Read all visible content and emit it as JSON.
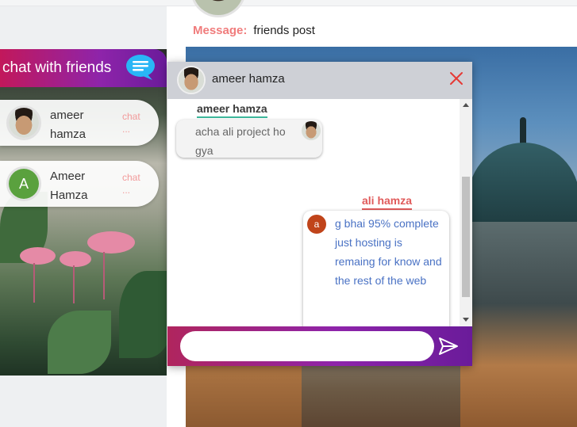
{
  "post": {
    "message_label": "Message:",
    "message_text": "friends post"
  },
  "friends_panel": {
    "title": "chat with friends",
    "items": [
      {
        "name": "ameer hamza",
        "action": "chat",
        "extra": "..."
      },
      {
        "name": "Ameer Hamza",
        "avatar_letter": "A",
        "action": "chat",
        "extra": "..."
      }
    ]
  },
  "chat": {
    "header_name": "ameer hamza",
    "messages": [
      {
        "sender": "ameer hamza",
        "text": "acha ali project ho gya"
      },
      {
        "sender": "ali hamza",
        "avatar_letter": "a",
        "text": "g bhai 95% complete just hosting is remaing for know and the rest of the web"
      }
    ],
    "input_value": "",
    "input_placeholder": ""
  },
  "colors": {
    "accent_pink": "#c2185b",
    "accent_purple": "#6a1b9a",
    "label_red": "#f07c7c",
    "sender_green": "#3cb79a",
    "sender_red": "#e05a5a",
    "message_blue": "#4a72c4"
  },
  "icons": {
    "close": "close-icon",
    "send": "send-icon",
    "chat": "chat-bubble-icon"
  }
}
